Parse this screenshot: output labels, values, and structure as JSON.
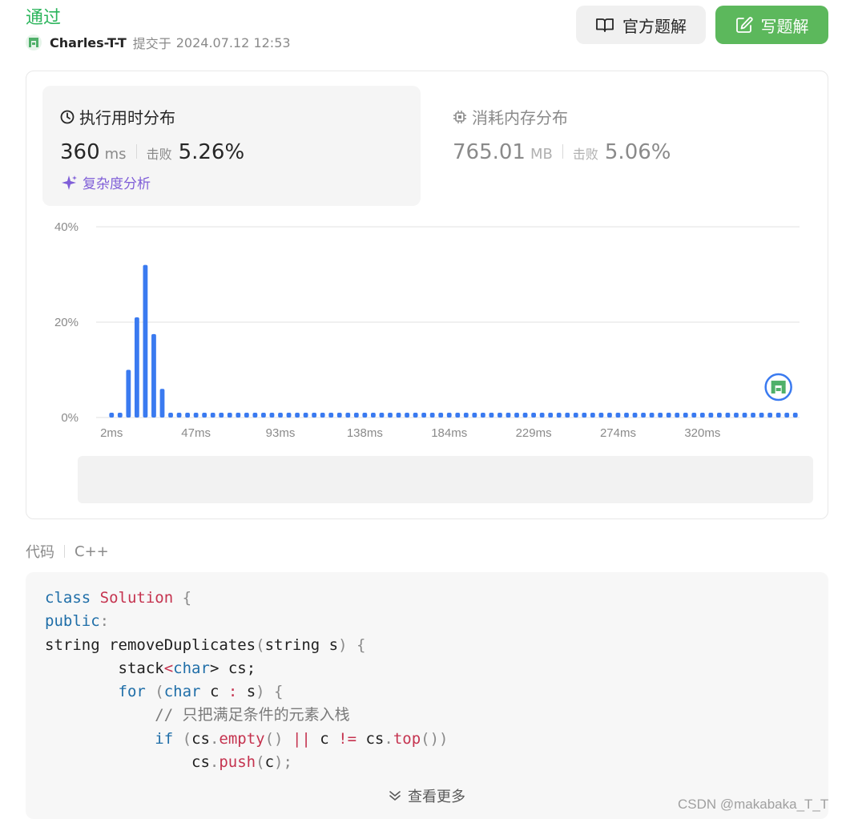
{
  "header": {
    "status": "通过",
    "username": "Charles-T-T",
    "submitted_label": "提交于",
    "submitted_at": "2024.07.12 12:53",
    "official_solution_label": "官方题解",
    "write_solution_label": "写题解"
  },
  "runtime": {
    "title": "执行用时分布",
    "value": "360",
    "unit": "ms",
    "beat_label": "击败",
    "beat_pct": "5.26%",
    "complexity_label": "复杂度分析"
  },
  "memory": {
    "title": "消耗内存分布",
    "value": "765.01",
    "unit": "MB",
    "beat_label": "击败",
    "beat_pct": "5.06%"
  },
  "chart_data": {
    "type": "bar",
    "xlabel": "",
    "ylabel": "",
    "y_ticks": [
      "40%",
      "20%",
      "0%"
    ],
    "x_ticks": [
      "2ms",
      "47ms",
      "93ms",
      "138ms",
      "184ms",
      "229ms",
      "274ms",
      "320ms"
    ],
    "ylim": [
      0,
      40
    ],
    "values": [
      1,
      1,
      10,
      21,
      32,
      17.5,
      6,
      1,
      1,
      1,
      1,
      1,
      1,
      1,
      1,
      1,
      1,
      1,
      1,
      1,
      1,
      1,
      1,
      1,
      1,
      1,
      1,
      1,
      1,
      1,
      1,
      1,
      1,
      1,
      1,
      1,
      1,
      1,
      1,
      1,
      1,
      1,
      1,
      1,
      1,
      1,
      1,
      1,
      1,
      1,
      1,
      1,
      1,
      1,
      1,
      1,
      1,
      1,
      1,
      1,
      1,
      1,
      1,
      1,
      1,
      1,
      1,
      1,
      1,
      1,
      1,
      1,
      1,
      1,
      1,
      1,
      1,
      1,
      1,
      1,
      1,
      1
    ],
    "user_bin_index": 79,
    "grid": true,
    "accent_color": "#3a7af0",
    "nav_bar_color": "#e0e0e0"
  },
  "code": {
    "label": "代码",
    "language": "C++",
    "lines": [
      [
        [
          "class",
          "kw"
        ],
        [
          " ",
          ""
        ],
        [
          "Solution",
          "cls"
        ],
        [
          " {",
          "p"
        ]
      ],
      [
        [
          "public",
          "kw"
        ],
        [
          ":",
          "p"
        ]
      ],
      [
        [
          "string removeDuplicates",
          ""
        ],
        [
          "(",
          "p"
        ],
        [
          "string s",
          ""
        ],
        [
          ") {",
          "p"
        ]
      ],
      [
        [
          "        stack",
          ""
        ],
        [
          "<",
          "op"
        ],
        [
          "char",
          "kw"
        ],
        [
          "> cs;",
          ""
        ]
      ],
      [
        [
          "        ",
          ""
        ],
        [
          "for",
          "kw"
        ],
        [
          " (",
          "p"
        ],
        [
          "char",
          "kw"
        ],
        [
          " c ",
          ""
        ],
        [
          ":",
          "op"
        ],
        [
          " s",
          ""
        ],
        [
          ") {",
          "p"
        ]
      ],
      [
        [
          "            // 只把满足条件的元素入栈",
          "cm"
        ]
      ],
      [
        [
          "            ",
          ""
        ],
        [
          "if",
          "kw"
        ],
        [
          " (",
          "p"
        ],
        [
          "cs",
          ""
        ],
        [
          ".",
          "p"
        ],
        [
          "empty",
          "fn"
        ],
        [
          "()",
          "p"
        ],
        [
          " || ",
          "op"
        ],
        [
          "c ",
          ""
        ],
        [
          "!=",
          "op"
        ],
        [
          " cs",
          ""
        ],
        [
          ".",
          "p"
        ],
        [
          "top",
          "fn"
        ],
        [
          "())",
          "p"
        ]
      ],
      [
        [
          "                cs",
          ""
        ],
        [
          ".",
          "p"
        ],
        [
          "push",
          "fn"
        ],
        [
          "(",
          "p"
        ],
        [
          "c",
          ""
        ],
        [
          ");",
          "p"
        ]
      ]
    ],
    "show_more_label": "查看更多"
  },
  "colors": {
    "status_green": "#2db55d",
    "write_button": "#5cb85c",
    "complexity_purple": "#7f5ed8",
    "keyword": "#1f6ea8",
    "class_name": "#c5334f",
    "comment": "#7a7a7a"
  },
  "watermark": "CSDN @makabaka_T_T"
}
